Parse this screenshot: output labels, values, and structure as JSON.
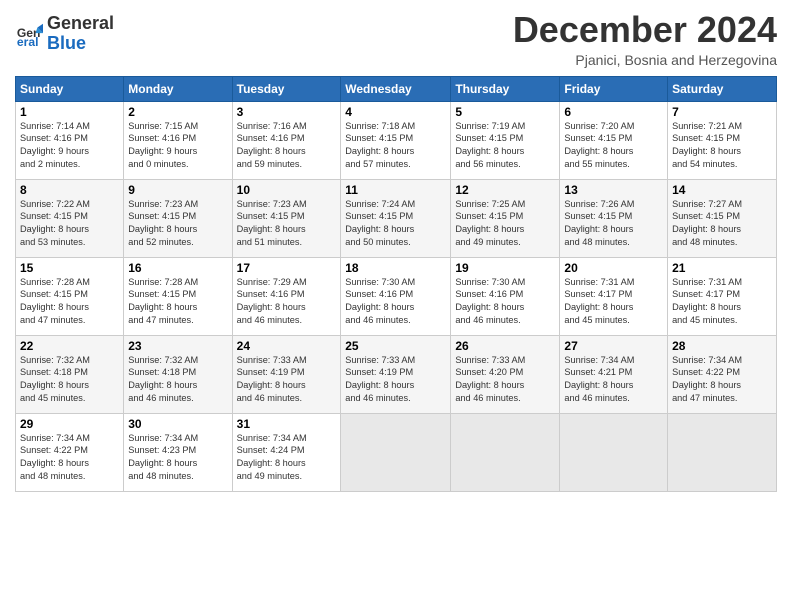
{
  "header": {
    "logo_line1": "General",
    "logo_line2": "Blue",
    "title": "December 2024",
    "location": "Pjanici, Bosnia and Herzegovina"
  },
  "columns": [
    "Sunday",
    "Monday",
    "Tuesday",
    "Wednesday",
    "Thursday",
    "Friday",
    "Saturday"
  ],
  "weeks": [
    [
      {
        "day": "1",
        "info": "Sunrise: 7:14 AM\nSunset: 4:16 PM\nDaylight: 9 hours\nand 2 minutes."
      },
      {
        "day": "2",
        "info": "Sunrise: 7:15 AM\nSunset: 4:16 PM\nDaylight: 9 hours\nand 0 minutes."
      },
      {
        "day": "3",
        "info": "Sunrise: 7:16 AM\nSunset: 4:16 PM\nDaylight: 8 hours\nand 59 minutes."
      },
      {
        "day": "4",
        "info": "Sunrise: 7:18 AM\nSunset: 4:15 PM\nDaylight: 8 hours\nand 57 minutes."
      },
      {
        "day": "5",
        "info": "Sunrise: 7:19 AM\nSunset: 4:15 PM\nDaylight: 8 hours\nand 56 minutes."
      },
      {
        "day": "6",
        "info": "Sunrise: 7:20 AM\nSunset: 4:15 PM\nDaylight: 8 hours\nand 55 minutes."
      },
      {
        "day": "7",
        "info": "Sunrise: 7:21 AM\nSunset: 4:15 PM\nDaylight: 8 hours\nand 54 minutes."
      }
    ],
    [
      {
        "day": "8",
        "info": "Sunrise: 7:22 AM\nSunset: 4:15 PM\nDaylight: 8 hours\nand 53 minutes."
      },
      {
        "day": "9",
        "info": "Sunrise: 7:23 AM\nSunset: 4:15 PM\nDaylight: 8 hours\nand 52 minutes."
      },
      {
        "day": "10",
        "info": "Sunrise: 7:23 AM\nSunset: 4:15 PM\nDaylight: 8 hours\nand 51 minutes."
      },
      {
        "day": "11",
        "info": "Sunrise: 7:24 AM\nSunset: 4:15 PM\nDaylight: 8 hours\nand 50 minutes."
      },
      {
        "day": "12",
        "info": "Sunrise: 7:25 AM\nSunset: 4:15 PM\nDaylight: 8 hours\nand 49 minutes."
      },
      {
        "day": "13",
        "info": "Sunrise: 7:26 AM\nSunset: 4:15 PM\nDaylight: 8 hours\nand 48 minutes."
      },
      {
        "day": "14",
        "info": "Sunrise: 7:27 AM\nSunset: 4:15 PM\nDaylight: 8 hours\nand 48 minutes."
      }
    ],
    [
      {
        "day": "15",
        "info": "Sunrise: 7:28 AM\nSunset: 4:15 PM\nDaylight: 8 hours\nand 47 minutes."
      },
      {
        "day": "16",
        "info": "Sunrise: 7:28 AM\nSunset: 4:15 PM\nDaylight: 8 hours\nand 47 minutes."
      },
      {
        "day": "17",
        "info": "Sunrise: 7:29 AM\nSunset: 4:16 PM\nDaylight: 8 hours\nand 46 minutes."
      },
      {
        "day": "18",
        "info": "Sunrise: 7:30 AM\nSunset: 4:16 PM\nDaylight: 8 hours\nand 46 minutes."
      },
      {
        "day": "19",
        "info": "Sunrise: 7:30 AM\nSunset: 4:16 PM\nDaylight: 8 hours\nand 46 minutes."
      },
      {
        "day": "20",
        "info": "Sunrise: 7:31 AM\nSunset: 4:17 PM\nDaylight: 8 hours\nand 45 minutes."
      },
      {
        "day": "21",
        "info": "Sunrise: 7:31 AM\nSunset: 4:17 PM\nDaylight: 8 hours\nand 45 minutes."
      }
    ],
    [
      {
        "day": "22",
        "info": "Sunrise: 7:32 AM\nSunset: 4:18 PM\nDaylight: 8 hours\nand 45 minutes."
      },
      {
        "day": "23",
        "info": "Sunrise: 7:32 AM\nSunset: 4:18 PM\nDaylight: 8 hours\nand 46 minutes."
      },
      {
        "day": "24",
        "info": "Sunrise: 7:33 AM\nSunset: 4:19 PM\nDaylight: 8 hours\nand 46 minutes."
      },
      {
        "day": "25",
        "info": "Sunrise: 7:33 AM\nSunset: 4:19 PM\nDaylight: 8 hours\nand 46 minutes."
      },
      {
        "day": "26",
        "info": "Sunrise: 7:33 AM\nSunset: 4:20 PM\nDaylight: 8 hours\nand 46 minutes."
      },
      {
        "day": "27",
        "info": "Sunrise: 7:34 AM\nSunset: 4:21 PM\nDaylight: 8 hours\nand 46 minutes."
      },
      {
        "day": "28",
        "info": "Sunrise: 7:34 AM\nSunset: 4:22 PM\nDaylight: 8 hours\nand 47 minutes."
      }
    ],
    [
      {
        "day": "29",
        "info": "Sunrise: 7:34 AM\nSunset: 4:22 PM\nDaylight: 8 hours\nand 48 minutes."
      },
      {
        "day": "30",
        "info": "Sunrise: 7:34 AM\nSunset: 4:23 PM\nDaylight: 8 hours\nand 48 minutes."
      },
      {
        "day": "31",
        "info": "Sunrise: 7:34 AM\nSunset: 4:24 PM\nDaylight: 8 hours\nand 49 minutes."
      },
      {
        "day": "",
        "info": ""
      },
      {
        "day": "",
        "info": ""
      },
      {
        "day": "",
        "info": ""
      },
      {
        "day": "",
        "info": ""
      }
    ]
  ]
}
